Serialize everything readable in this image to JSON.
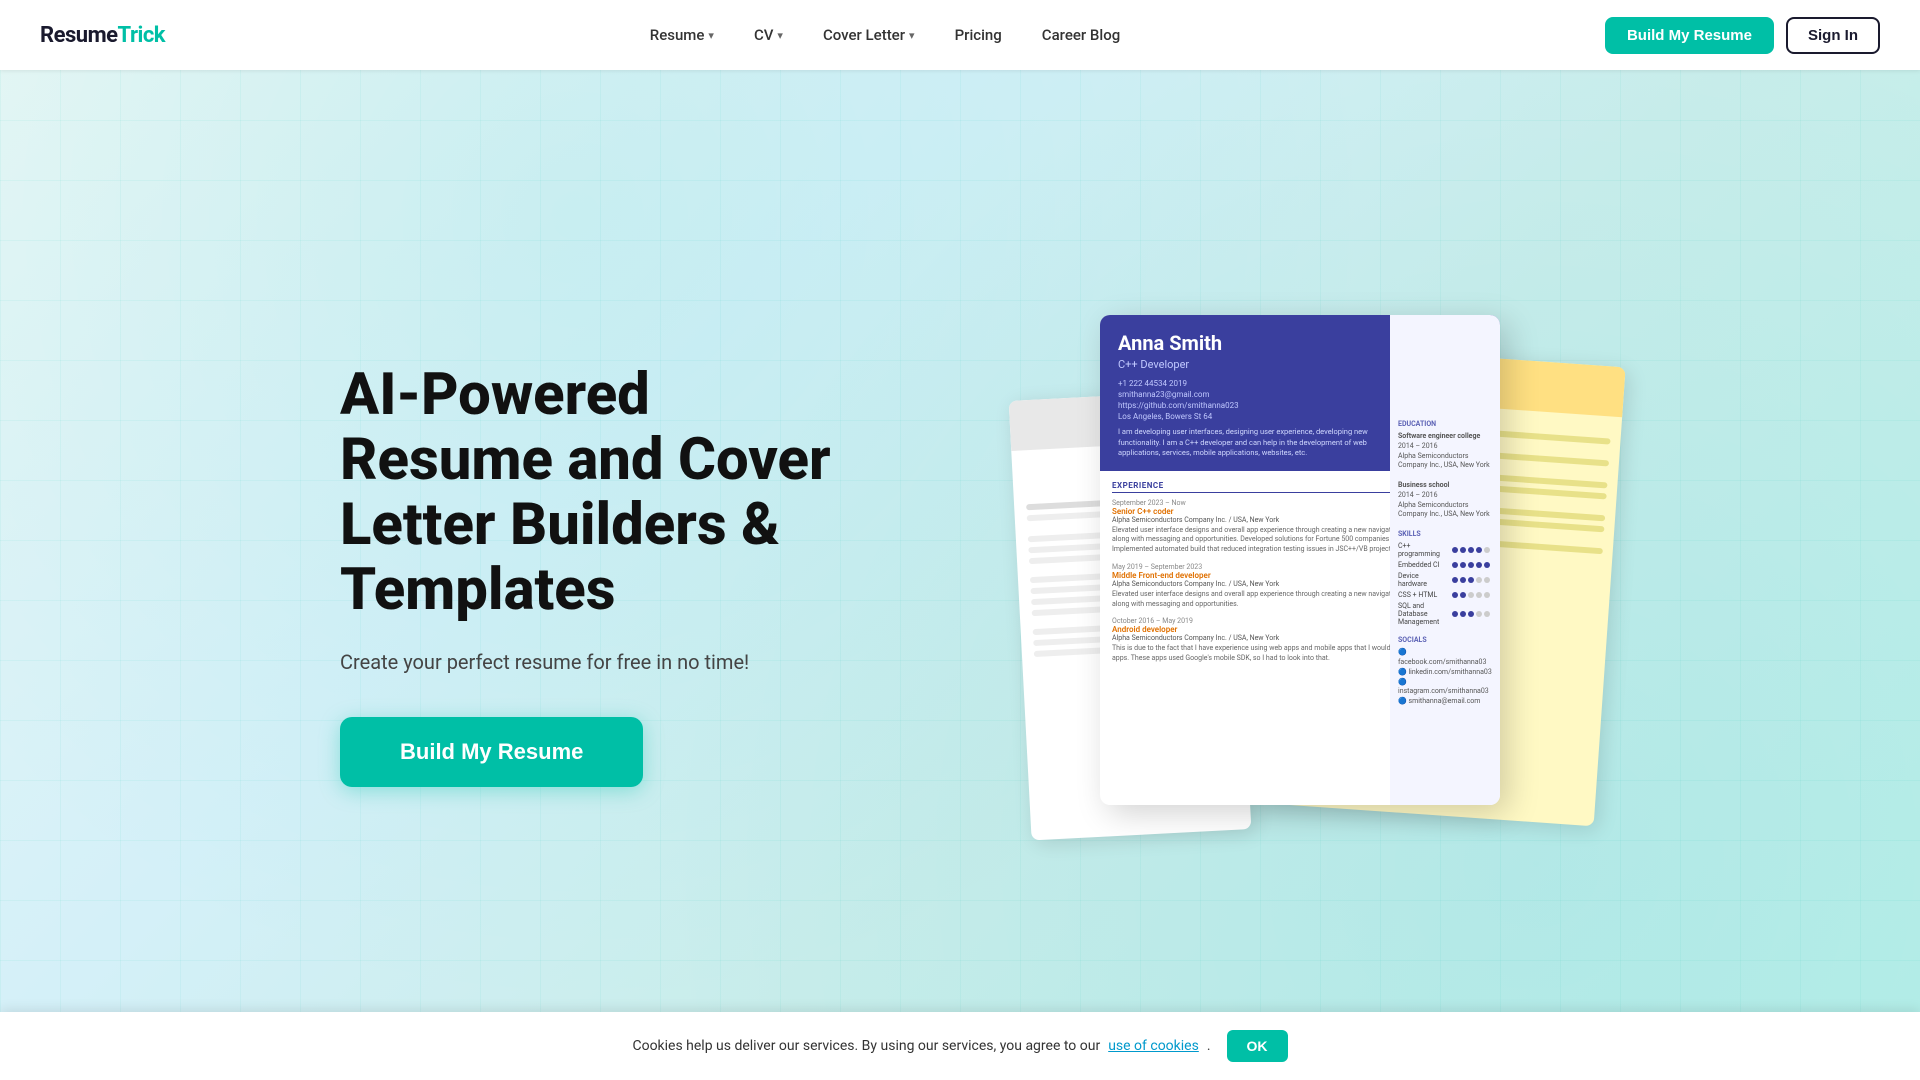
{
  "brand": {
    "name_part1": "Resume",
    "name_part2": "Trick"
  },
  "nav": {
    "items": [
      {
        "label": "Resume",
        "has_dropdown": true
      },
      {
        "label": "CV",
        "has_dropdown": true
      },
      {
        "label": "Cover Letter",
        "has_dropdown": true
      },
      {
        "label": "Pricing",
        "has_dropdown": false
      },
      {
        "label": "Career Blog",
        "has_dropdown": false
      }
    ],
    "cta_label": "Build My Resume",
    "signin_label": "Sign In"
  },
  "hero": {
    "headline": "AI-Powered Resume and Cover Letter Builders & Templates",
    "subtext": "Create your perfect resume for free in no time!",
    "cta_label": "Build My Resume"
  },
  "resume_preview": {
    "name": "Anna Smith",
    "title": "C++ Developer",
    "contact": [
      "+1 222 44534 2019",
      "smithanna23@gmail.com",
      "https://github.com/smithanna023",
      "Los Angeles, Bowers St 64"
    ],
    "summary": "I am developing user interfaces, designing user experience, developing new functionality. I am a C++ developer and can help in the development of web applications, services, mobile applications, websites, etc.",
    "experience": [
      {
        "date": "September 2023 – Now",
        "role": "Senior C++ coder",
        "company": "Alpha Semiconductors Company Inc. / USA, New York"
      },
      {
        "date": "May 2019 – September 2023",
        "role": "Middle Front-end developer",
        "company": "Alpha Semiconductors Company Inc. / USA, New York"
      },
      {
        "date": "October 2016 – May 2019",
        "role": "Android developer",
        "company": "Alpha Semiconductors Company Inc. / USA, New York"
      }
    ],
    "skills": [
      {
        "name": "C++ programming",
        "filled": 4,
        "total": 5
      },
      {
        "name": "Embedded CI",
        "filled": 5,
        "total": 5
      },
      {
        "name": "Device hardware",
        "filled": 3,
        "total": 5
      },
      {
        "name": "CSS + HTML",
        "filled": 2,
        "total": 5
      },
      {
        "name": "SQL and Database Management",
        "filled": 3,
        "total": 5
      }
    ],
    "side_education": [
      "Software engineer college 2014 – 2016",
      "Alpha Semiconductors Company Inc., USA, New York",
      "Business school",
      "2014 – 2016 Alpha Semiconductors Company Inc., USA, New York"
    ],
    "social": [
      "facebook.com/smithanna03",
      "linkedin.com/smithanna03",
      "instagram.com/smithanna03",
      "smithanna@email.com"
    ]
  },
  "cookie": {
    "text": "Cookies help us deliver our services. By using our services, you agree to our",
    "link_text": "use of cookies",
    "period": ".",
    "ok_label": "OK"
  }
}
